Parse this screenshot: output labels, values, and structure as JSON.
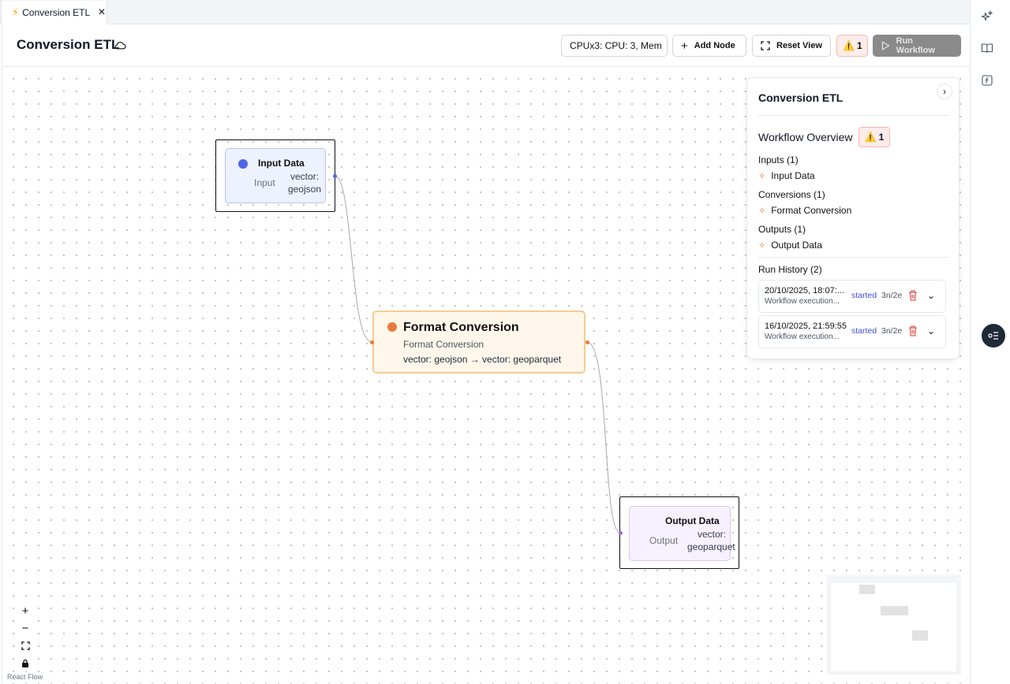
{
  "tab": {
    "label": "Conversion ETL"
  },
  "header": {
    "title": "Conversion ETL",
    "resources_select": "CPUx3: CPU: 3, Mem",
    "add_node_label": "Add Node",
    "reset_view_label": "Reset View",
    "warning_count": "1",
    "run_label": "Run Workflow"
  },
  "nodes": {
    "input": {
      "title": "Input Data",
      "kind": "Input",
      "value_line1": "vector:",
      "value_line2": "geojson",
      "color": "#4f63e8"
    },
    "conversion": {
      "title": "Format Conversion",
      "subtitle": "Format Conversion",
      "mapping": "vector: geojson → vector: geoparquet",
      "color": "#ea7a3c"
    },
    "output": {
      "title": "Output Data",
      "kind": "Output",
      "value_line1": "vector:",
      "value_line2": "geoparquet"
    }
  },
  "overview": {
    "title": "Conversion ETL",
    "section_title": "Workflow Overview",
    "warning_count": "1",
    "inputs_header": "Inputs (1)",
    "inputs": [
      "Input Data"
    ],
    "conversions_header": "Conversions (1)",
    "conversions": [
      "Format Conversion"
    ],
    "outputs_header": "Outputs (1)",
    "outputs": [
      "Output Data"
    ],
    "history_header": "Run History (2)",
    "runs": [
      {
        "date": "20/10/2025, 18:07:...",
        "desc": "Workflow execution...",
        "status": "started",
        "count": "3n/2e"
      },
      {
        "date": "16/10/2025, 21:59:55",
        "desc": "Workflow execution...",
        "status": "started",
        "count": "3n/2e"
      }
    ]
  },
  "controls": {
    "zoom_in": "+",
    "zoom_out": "−",
    "attribution": "React Flow"
  },
  "icons": [
    "bolt-icon",
    "close-icon",
    "cloud-icon",
    "plus-icon",
    "fit-view-icon",
    "warning-icon",
    "play-icon",
    "chevron-right-icon",
    "ellipsis-icon",
    "trash-icon",
    "chevron-down-icon",
    "lock-icon",
    "sparkles-icon",
    "book-icon",
    "function-icon",
    "list-toggle-icon"
  ]
}
